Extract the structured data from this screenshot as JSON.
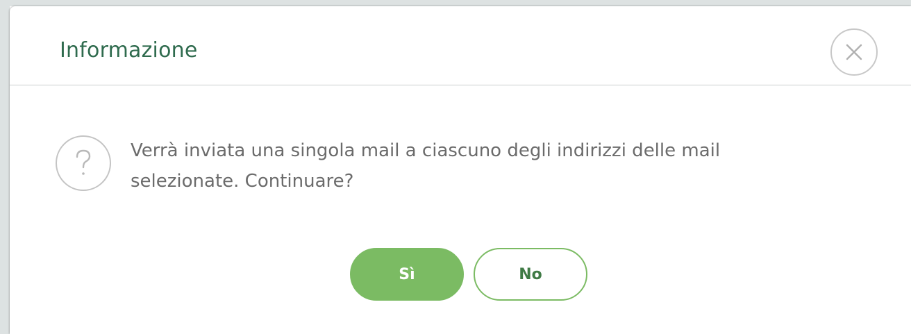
{
  "dialog": {
    "title": "Informazione",
    "close_icon": "close-x-icon",
    "message_icon": "question-mark-icon",
    "message_line1": "Verrà inviata una singola mail a ciascuno degli indirizzi delle mail",
    "message_line2": "selezionate. Continuare?",
    "buttons": {
      "yes_label": "Sì",
      "no_label": "No"
    }
  },
  "colors": {
    "title": "#2f6b4e",
    "primary_button": "#7bbb63",
    "text": "#6b6b6b",
    "icon_border": "#c4c4c4",
    "backdrop": "#dde2e2"
  }
}
